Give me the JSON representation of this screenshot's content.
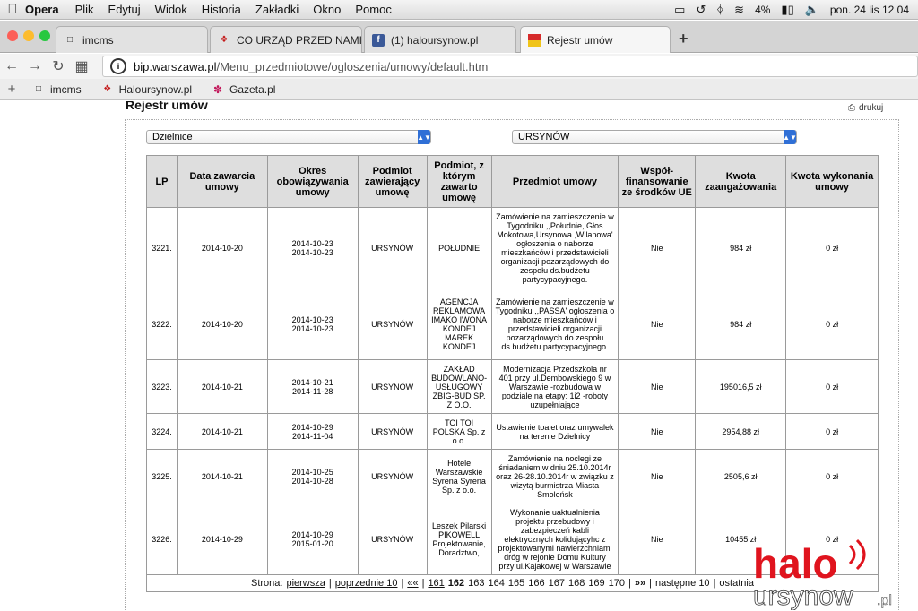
{
  "menubar": {
    "app": "Opera",
    "items": [
      "Plik",
      "Edytuj",
      "Widok",
      "Historia",
      "Zakładki",
      "Okno",
      "Pomoc"
    ],
    "battery": "4%",
    "datetime": "pon. 24 lis 12 04"
  },
  "tabs": [
    {
      "label": "imcms",
      "active": false
    },
    {
      "label": "CO URZĄD PRZED NAMI UKRY",
      "active": false
    },
    {
      "label": "(1) haloursynow.pl",
      "active": false
    },
    {
      "label": "Rejestr umów",
      "active": true
    }
  ],
  "address": {
    "domain": "bip.warszawa.pl",
    "path": "/Menu_przedmiotowe/ogloszenia/umowy/default.htm"
  },
  "bookmarks": [
    "imcms",
    "Haloursynow.pl",
    "Gazeta.pl"
  ],
  "page": {
    "title": "Rejestr umów",
    "print": "drukuj",
    "select_left": "Dzielnice",
    "select_right": "URSYNÓW"
  },
  "table": {
    "headers": [
      "LP",
      "Data zawarcia umowy",
      "Okres obowiązywania umowy",
      "Podmiot zawierający umowę",
      "Podmiot, z którym zawarto umowę",
      "Przedmiot umowy",
      "Współ-finansowanie ze środków UE",
      "Kwota zaangażowania",
      "Kwota wykonania umowy"
    ],
    "rows": [
      {
        "lp": "3221.",
        "date": "2014-10-20",
        "from": "2014-10-23",
        "to": "2014-10-23",
        "entity": "URSYNÓW",
        "contractor": "POŁUDNIE",
        "subject": "Zamówienie na zamieszczenie w Tygodniku ,,Południe, Głos Mokotowa,Ursynowa ,Wilanowa' ogłoszenia o naborze mieszkańców i przedstawicieli organizacji pozarządowych do zespołu ds.budżetu partycypacyjnego.",
        "eu": "Nie",
        "amount": "984 zł",
        "executed": "0 zł"
      },
      {
        "lp": "3222.",
        "date": "2014-10-20",
        "from": "2014-10-23",
        "to": "2014-10-23",
        "entity": "URSYNÓW",
        "contractor": "AGENCJA REKLAMOWA IMAKO IWONA KONDEJ MAREK KONDEJ",
        "subject": "Zamówienie na zamieszczenie w Tygodniku ,,PASSA' ogłoszenia o naborze mieszkańców i przedstawicieli organizacji pozarządowych do zespołu ds.budżetu partycypacyjnego.",
        "eu": "Nie",
        "amount": "984 zł",
        "executed": "0 zł"
      },
      {
        "lp": "3223.",
        "date": "2014-10-21",
        "from": "2014-10-21",
        "to": "2014-11-28",
        "entity": "URSYNÓW",
        "contractor": "ZAKŁAD BUDOWLANO-USŁUGOWY ZBIG-BUD SP. Z O.O.",
        "subject": "Modernizacja Przedszkola nr 401 przy ul.Dembowskiego 9 w Warszawie -rozbudowa w podziale na etapy: 1i2 -roboty uzupełniające",
        "eu": "Nie",
        "amount": "195016,5 zł",
        "executed": "0 zł"
      },
      {
        "lp": "3224.",
        "date": "2014-10-21",
        "from": "2014-10-29",
        "to": "2014-11-04",
        "entity": "URSYNÓW",
        "contractor": "TOI TOI POLSKA Sp. z o.o.",
        "subject": "Ustawienie toalet oraz umywalek na terenie Dzielnicy",
        "eu": "Nie",
        "amount": "2954,88 zł",
        "executed": "0 zł"
      },
      {
        "lp": "3225.",
        "date": "2014-10-21",
        "from": "2014-10-25",
        "to": "2014-10-28",
        "entity": "URSYNÓW",
        "contractor": "Hotele Warszawskie Syrena Syrena Sp. z o.o.",
        "subject": "Zamówienie na noclegi ze śniadaniem w dniu 25.10.2014r oraz 26-28.10.2014r w związku z wizytą burmistrza Miasta Smoleńsk",
        "eu": "Nie",
        "amount": "2505,6 zł",
        "executed": "0 zł"
      },
      {
        "lp": "3226.",
        "date": "2014-10-29",
        "from": "2014-10-29",
        "to": "2015-01-20",
        "entity": "URSYNÓW",
        "contractor": "Leszek Pilarski PIKOWELL Projektowanie, Doradztwo,",
        "subject": "Wykonanie uaktualnienia projektu przebudowy i zabezpieczeń kabli elektrycznych kolidującyhc z projektowanymi nawierzchniami dróg w rejonie Domu Kultury przy ul.Kajakowej w Warszawie",
        "eu": "Nie",
        "amount": "10455 zł",
        "executed": "0 zł"
      }
    ]
  },
  "pager": {
    "label": "Strona:",
    "first": "pierwsza",
    "prev10": "poprzednie 10",
    "prev": "««",
    "pages": [
      "161",
      "162",
      "163",
      "164",
      "165",
      "166",
      "167",
      "168",
      "169",
      "170"
    ],
    "current": "162",
    "next": "»»",
    "next10": "następne 10",
    "last": "ostatnia"
  },
  "watermark": {
    "word1": "halo",
    "word2": "ursynow",
    "suffix": ".pl"
  },
  "colors": {
    "accent": "#2f6fd6",
    "header_bg": "#dedede",
    "watermark_red": "#e0141e"
  }
}
